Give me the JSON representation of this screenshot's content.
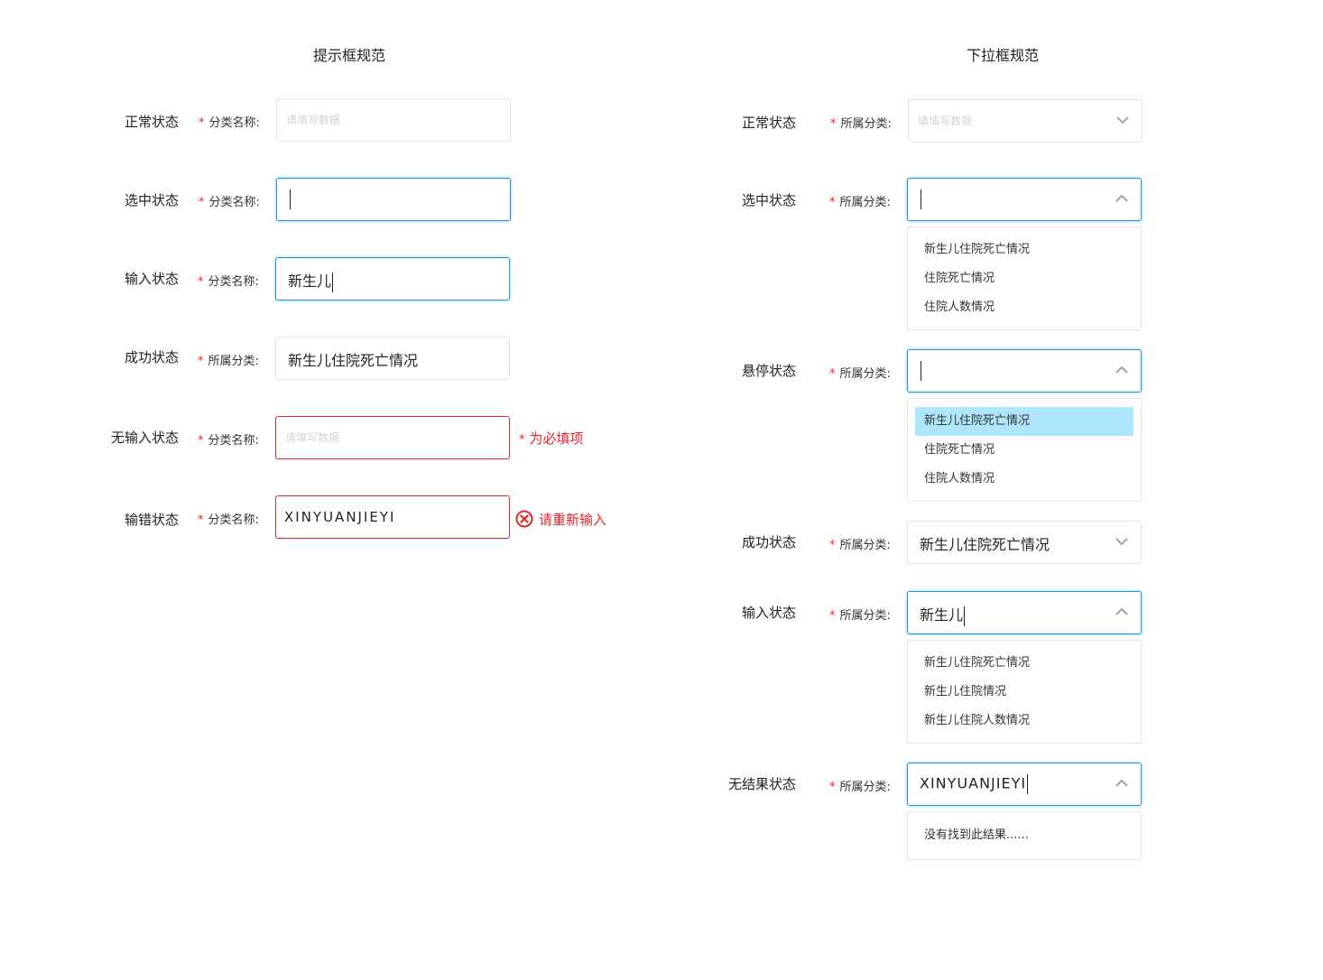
{
  "left": {
    "title": "提示框规范",
    "rows": [
      {
        "state": "正常状态",
        "label": "分类名称:",
        "placeholder": "请填写数据"
      },
      {
        "state": "选中状态",
        "label": "分类名称:"
      },
      {
        "state": "输入状态",
        "label": "分类名称:",
        "value": "新生儿"
      },
      {
        "state": "成功状态",
        "label": "所属分类:",
        "value": "新生儿住院死亡情况"
      },
      {
        "state": "无输入状态",
        "label": "分类名称:",
        "placeholder": "请填写数据",
        "message": "为必填项"
      },
      {
        "state": "输错状态",
        "label": "分类名称:",
        "value": "XINYUANJIEYI",
        "message": "请重新输入"
      }
    ]
  },
  "right": {
    "title": "下拉框规范",
    "rows": [
      {
        "state": "正常状态",
        "label": "所属分类:",
        "placeholder": "请填写数据"
      },
      {
        "state": "选中状态",
        "label": "所属分类:",
        "options": [
          "新生儿住院死亡情况",
          "住院死亡情况",
          "住院人数情况"
        ]
      },
      {
        "state": "悬停状态",
        "label": "所属分类:",
        "options": [
          "新生儿住院死亡情况",
          "住院死亡情况",
          "住院人数情况"
        ],
        "highlighted_index": 0
      },
      {
        "state": "成功状态",
        "label": "所属分类:",
        "value": "新生儿住院死亡情况"
      },
      {
        "state": "输入状态",
        "label": "所属分类:",
        "value": "新生儿",
        "options": [
          "新生儿住院死亡情况",
          "新生儿住院情况",
          "新生儿住院人数情况"
        ]
      },
      {
        "state": "无结果状态",
        "label": "所属分类:",
        "value": "XINYUANJIEYI",
        "empty_text": "没有找到此结果......"
      }
    ]
  },
  "required_mark": "*",
  "colors": {
    "active_border": "#1a9bd7",
    "error": "#e5262a",
    "highlight": "#ade6fd",
    "placeholder": "#d2d2d2"
  },
  "icons": [
    "chevron-down-icon",
    "chevron-up-icon",
    "error-circle-icon"
  ]
}
